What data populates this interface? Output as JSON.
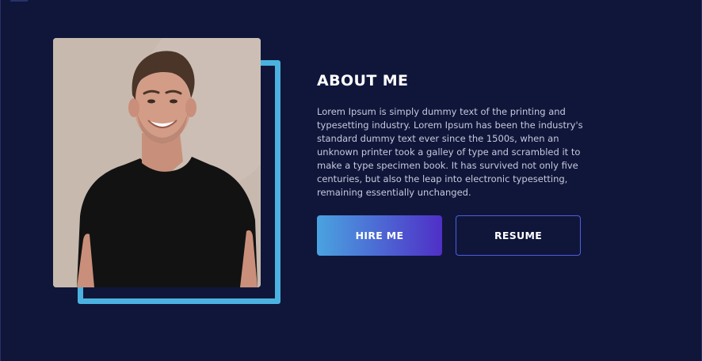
{
  "about": {
    "title": "ABOUT ME",
    "description": "Lorem Ipsum is simply dummy text of the printing and typesetting industry. Lorem Ipsum has been the industry's standard dummy text ever since the 1500s, when an unknown printer took a galley of type and scrambled it to make a type specimen book. It has survived not only five centuries, but also the leap into electronic typesetting, remaining essentially unchanged."
  },
  "buttons": {
    "hire_label": "HIRE ME",
    "resume_label": "RESUME"
  },
  "colors": {
    "background": "#10163a",
    "frame_accent": "#4bb2e0",
    "button_gradient_start": "#4aa3e0",
    "button_gradient_end": "#4f2fc7",
    "outline_border": "#4f5de0"
  }
}
